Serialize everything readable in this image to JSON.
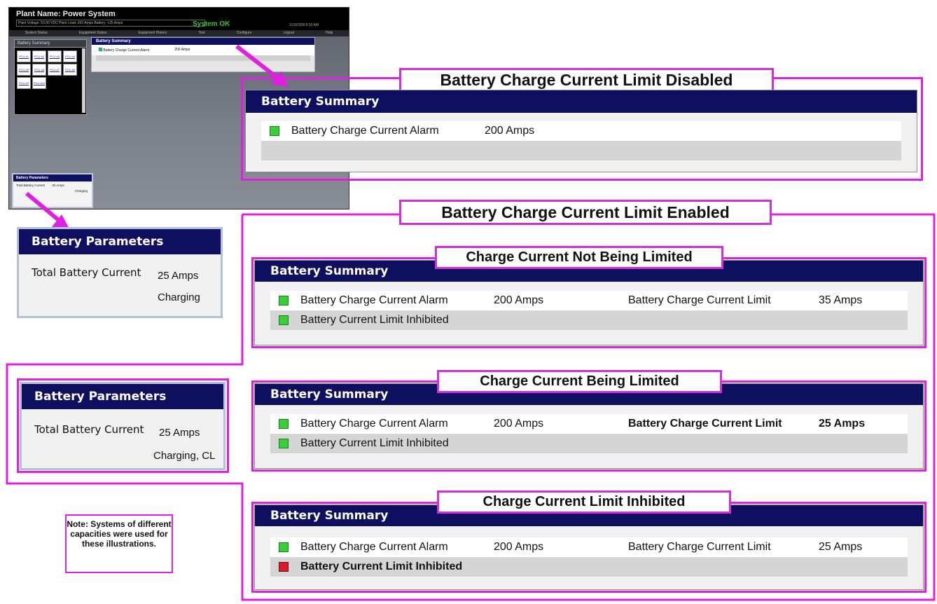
{
  "mini": {
    "plant_title": "Plant Name: Power System",
    "status_line": "Plant Voltage: 53.00 VDC  Plant Load: 200 Amps  Battery: +25 Amps",
    "status_ok": "System OK",
    "date": "1/19/2009 8:30 AM",
    "menu": [
      "System Status",
      "Equipment Status",
      "Equipment History",
      "Tool",
      "Configure",
      "Logout",
      "Help"
    ],
    "panel_title": "Battery Summary",
    "cells": [
      "PCU #1",
      "PCU #2",
      "PCU #3",
      "PCU #4",
      "PCU #5",
      "PCU #6",
      "PCU #7",
      "PCU #8",
      "PCU #9",
      "PCU #10"
    ],
    "summary_title": "Battery Summary",
    "summary_alarm": "Battery Charge Current Alarm",
    "summary_alarm_value": "200 Amps",
    "params_title": "Battery Parameters",
    "params_label": "Total Battery Current",
    "params_value": "25 Amps",
    "params_state": "Charging"
  },
  "disabled": {
    "title": "Battery Charge Current Limit Disabled",
    "window_title": "Battery Summary",
    "alarm_label": "Battery Charge Current Alarm",
    "alarm_value": "200 Amps"
  },
  "enabled": {
    "title": "Battery Charge Current Limit Enabled",
    "panels": [
      {
        "subtitle": "Charge Current Not Being Limited",
        "window_title": "Battery Summary",
        "alarm_label": "Battery Charge Current Alarm",
        "alarm_value": "200 Amps",
        "limit_label": "Battery Charge Current Limit",
        "limit_value": "35 Amps",
        "inhibit_label": "Battery Current Limit Inhibited"
      },
      {
        "subtitle": "Charge Current Being Limited",
        "window_title": "Battery Summary",
        "alarm_label": "Battery Charge Current Alarm",
        "alarm_value": "200 Amps",
        "limit_label": "Battery Charge Current Limit",
        "limit_value": "25 Amps",
        "inhibit_label": "Battery Current Limit Inhibited"
      },
      {
        "subtitle": "Charge Current Limit Inhibited",
        "window_title": "Battery Summary",
        "alarm_label": "Battery Charge Current Alarm",
        "alarm_value": "200 Amps",
        "limit_label": "Battery Charge Current Limit",
        "limit_value": "25 Amps",
        "inhibit_label": "Battery Current Limit Inhibited"
      }
    ]
  },
  "params_charging": {
    "title": "Battery Parameters",
    "label": "Total Battery Current",
    "value": "25 Amps",
    "state": "Charging"
  },
  "params_limited": {
    "title": "Battery Parameters",
    "label": "Total Battery Current",
    "value": "25 Amps",
    "state": "Charging, CL"
  },
  "note": {
    "text": "Note: Systems of different capacities were used for these illustrations."
  },
  "colors": {
    "highlight": "#e020e0",
    "window_header": "#0f0f60",
    "status_ok": "#38d038",
    "status_alarm": "#d81c2b"
  }
}
